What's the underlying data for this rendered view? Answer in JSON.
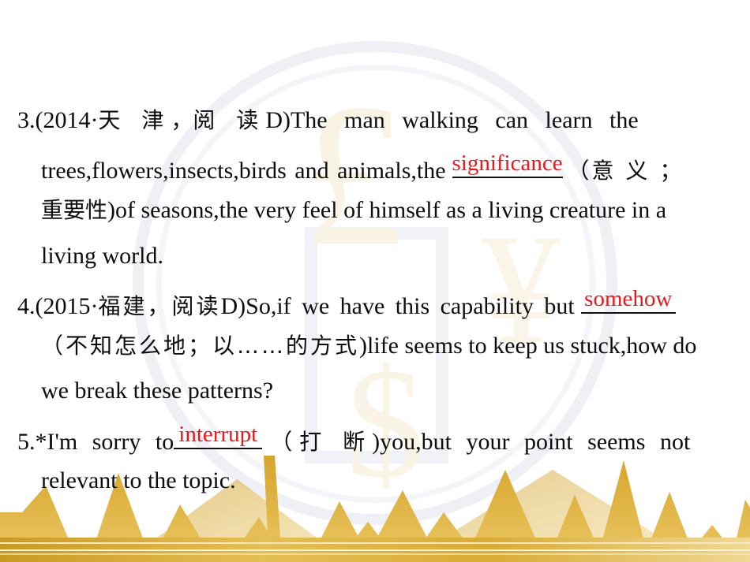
{
  "slide": {
    "background_color": "#ffffff",
    "accent_gold": "#d9a62a",
    "answer_color": "#e8191b",
    "text_color": "#0d0d0d",
    "watermark_color": "#f8f2e2",
    "watermark_ring_color": "#eef0f6"
  },
  "watermarks": {
    "pound": "£",
    "yen": "¥",
    "dollar": "$"
  },
  "questions": [
    {
      "number": "3.",
      "source": "(2014·",
      "region": "天 津",
      "comma": "，",
      "section": "阅 读",
      "paper": "D)",
      "lines": [
        "3.(2014·  天 津 ， 阅 读  D)The  man  walking  can  learn  the",
        "trees,flowers,insects,birds  and  animals,the  ____________ （意 义 ；",
        "重要性 )of seasons,the very feel of himself as a living creature in a",
        "living world."
      ],
      "answer": "significance",
      "hint": "意义；重要性"
    },
    {
      "number": "4.",
      "source": "(2015·",
      "region": "福建",
      "comma": "，",
      "section": "阅读",
      "paper": "D)",
      "lines": [
        "4.(2015· 福建，阅读 D)So,if  we  have  this  capability  but  ________",
        "（不知怎么地；以……的方式 )life seems to keep us stuck,how do",
        "we break these patterns?"
      ],
      "answer": "somehow",
      "hint": "不知怎么地；以……的方式"
    },
    {
      "number": "5.",
      "marker": "*",
      "lines": [
        "5.*I'm  sorry  to________ （打 断 )you,but  your  point  seems  not",
        "relevant to the topic."
      ],
      "answer": "interrupt",
      "hint": "打断"
    }
  ],
  "q3": {
    "l1_a": "3.(2014·",
    "l1_cn1": "天 津",
    "l1_cn2": "，",
    "l1_cn3": "阅 读",
    "l1_b": "D)The  man  walking  can  learn  the",
    "l2_a": "trees,flowers,insects,birds  and  animals,the",
    "l2_answer": "significance",
    "l2_cn": "（意 义 ；",
    "l3_cn": "重要性",
    "l3_b": ")of seasons,the very feel of himself as a living creature in a",
    "l4": "living world."
  },
  "q4": {
    "l1_a": "4.(2015·",
    "l1_cn1": "福建，阅读",
    "l1_b": "D)So,if  we  have  this  capability  but",
    "l1_answer": "somehow",
    "l2_cn": "（不知怎么地；以……的方式",
    "l2_b": ")life seems to keep us stuck,how do",
    "l3": "we break these patterns?"
  },
  "q5": {
    "l1_a": "5.*I'm  sorry  to",
    "l1_answer": "interrupt",
    "l1_cn": "（打 断",
    "l1_b": ")you,but  your  point  seems  not",
    "l2": "relevant to the topic."
  }
}
